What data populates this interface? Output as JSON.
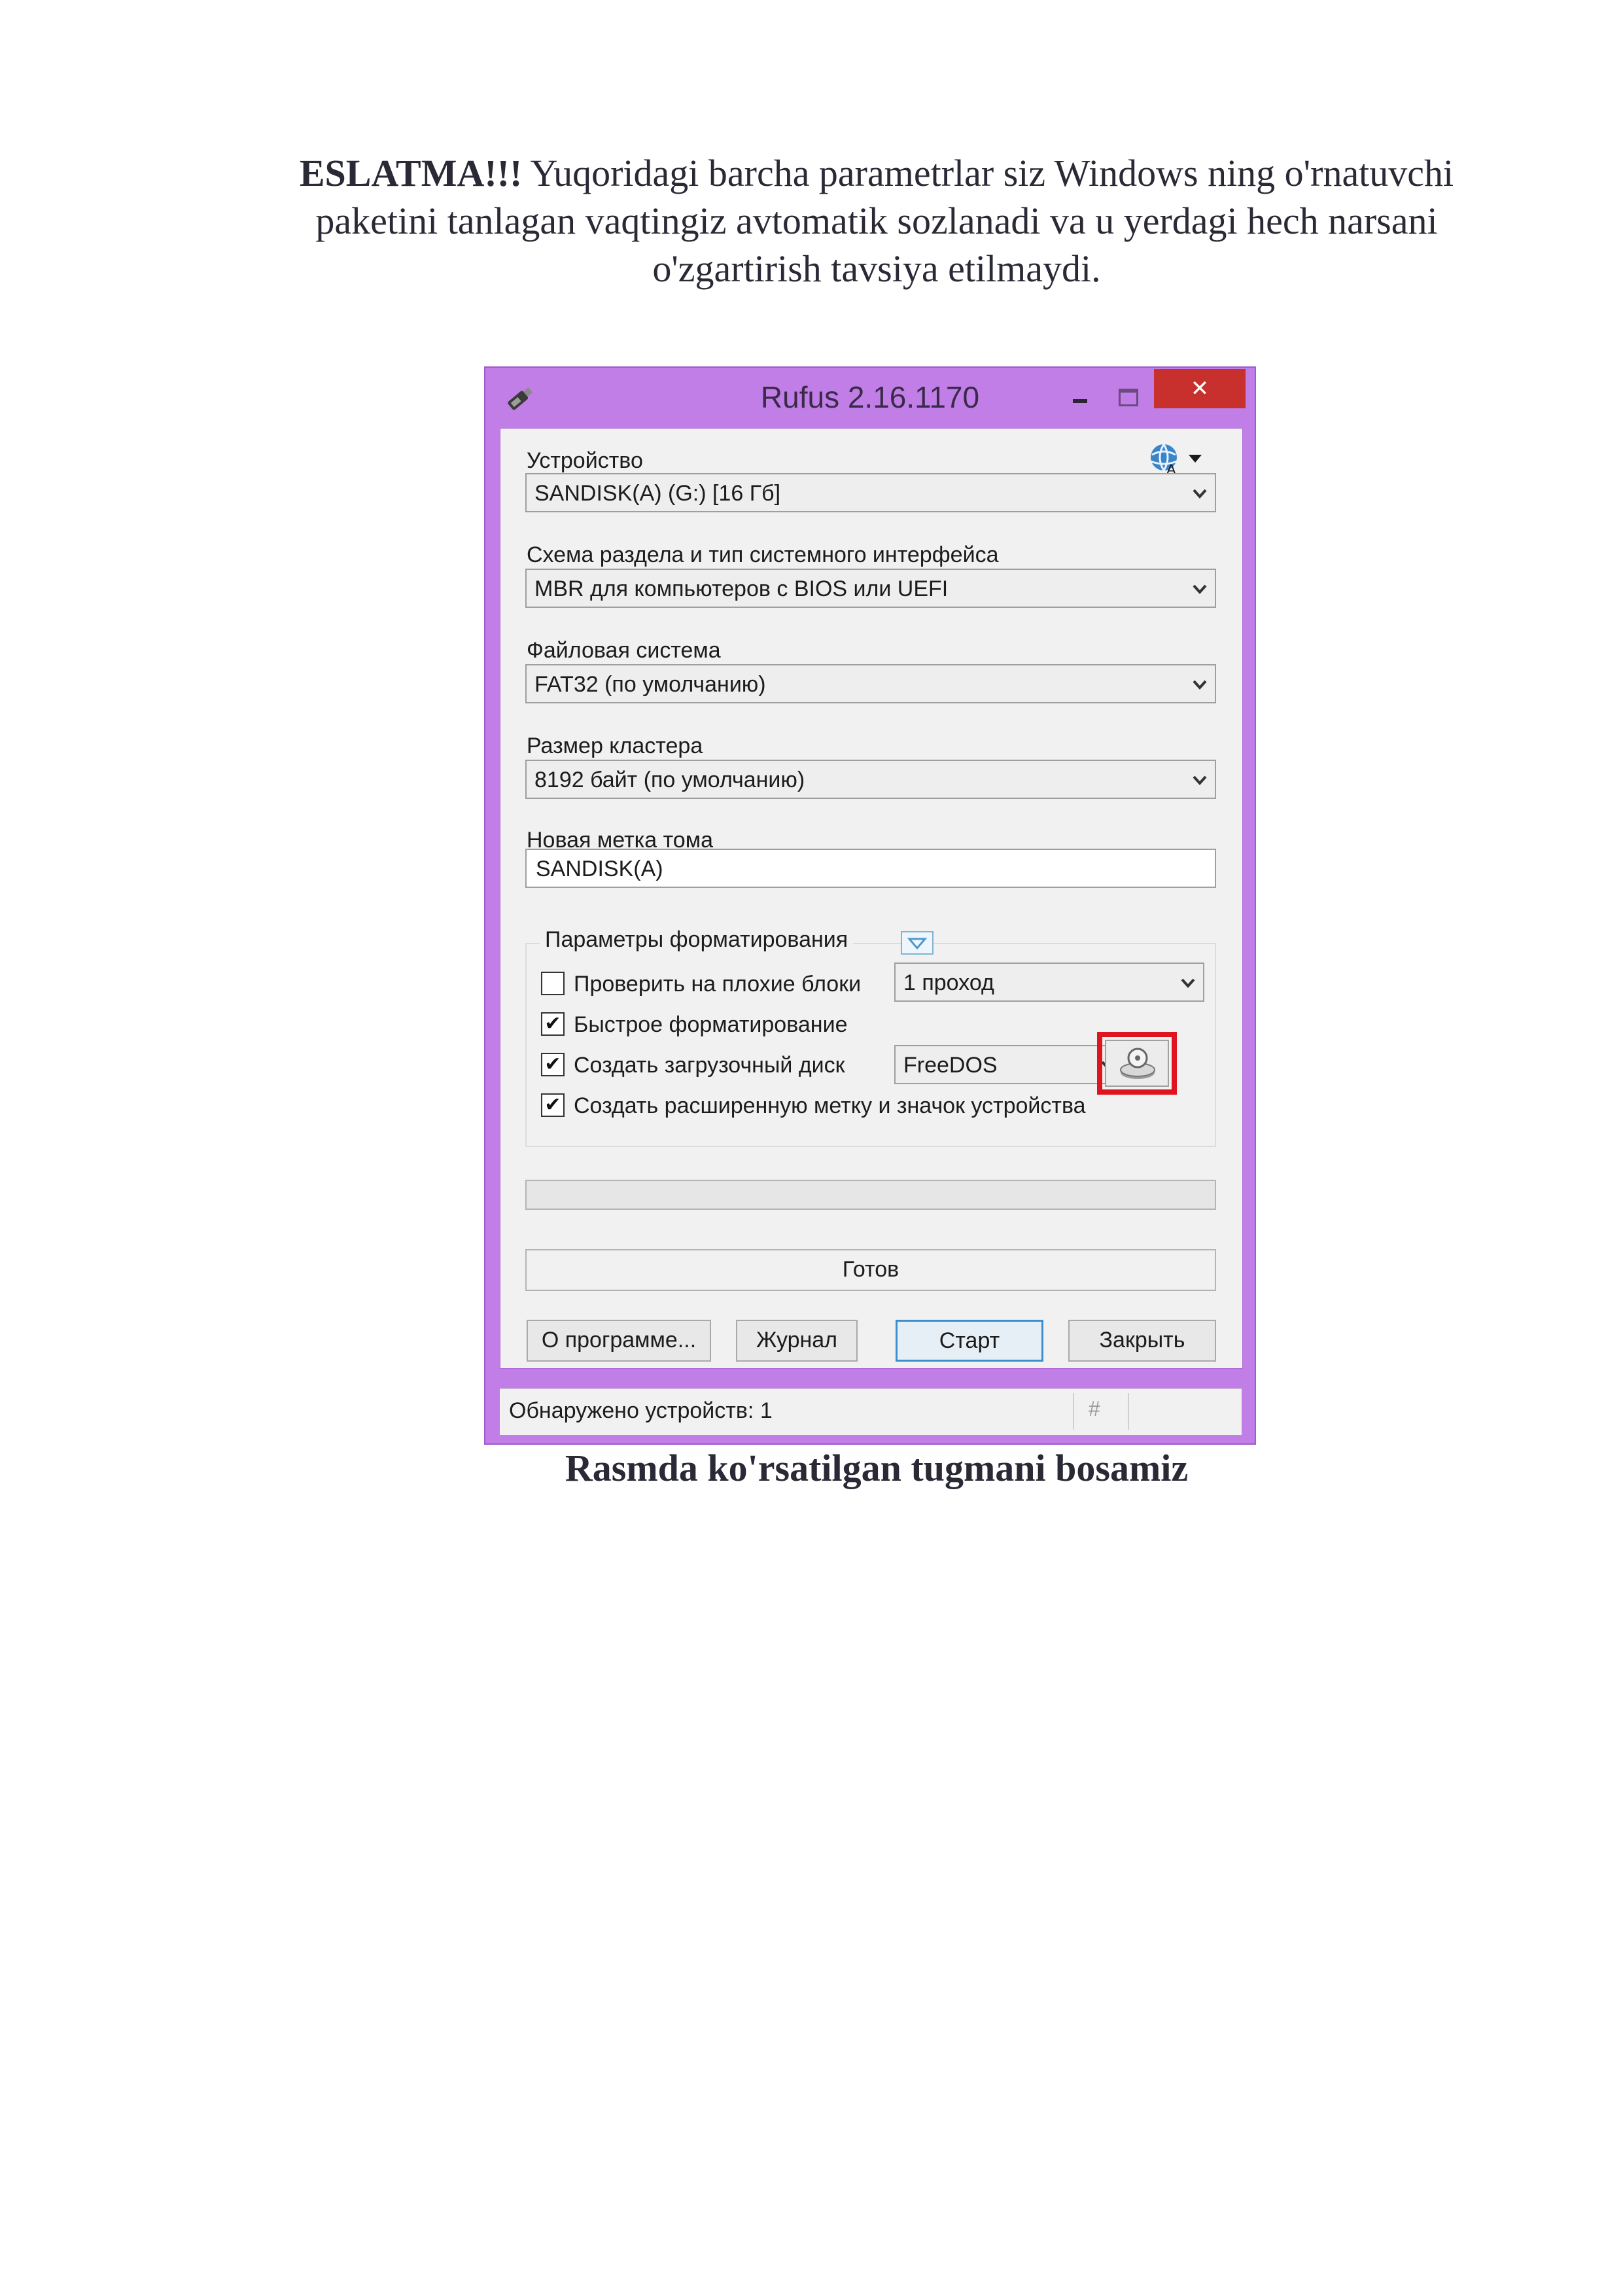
{
  "note": {
    "lead": "ESLATMA!!!",
    "lines": [
      " Yuqoridagi barcha parametrlar siz Windows ning o'rnatuvchi",
      "paketini tanlagan vaqtingiz avtomatik sozlanadi va u yerdagi hech narsani",
      "o'zgartirish tavsiya etilmaydi."
    ]
  },
  "window": {
    "title": "Rufus 2.16.1170",
    "close_glyph": "✕",
    "device_label": "Устройство",
    "device_value": "SANDISK(A) (G:) [16 Гб]",
    "scheme_label": "Схема раздела и тип системного интерфейса",
    "scheme_value": "MBR для компьютеров с BIOS или UEFI",
    "fs_label": "Файловая система",
    "fs_value": "FAT32 (по умолчанию)",
    "cluster_label": "Размер кластера",
    "cluster_value": "8192 байт (по умолчанию)",
    "volume_label": "Новая метка тома",
    "volume_value": "SANDISK(A)",
    "format_group_title": "Параметры форматирования",
    "check_bad_blocks": {
      "label": "Проверить на плохие блоки",
      "checked": false,
      "passes": "1 проход"
    },
    "quick_format": {
      "label": "Быстрое форматирование",
      "checked": true
    },
    "bootable": {
      "label": "Создать загрузочный диск",
      "checked": true,
      "type": "FreeDOS"
    },
    "extended_label": {
      "label": "Создать расширенную метку и значок устройства",
      "checked": true
    },
    "status": "Готов",
    "buttons": {
      "about": "О программе...",
      "log": "Журнал",
      "start": "Старт",
      "close": "Закрыть"
    },
    "statusbar": {
      "devices": "Обнаружено устройств: 1",
      "hash": "#"
    },
    "icons": [
      "usb-drive-icon",
      "language-globe-icon",
      "optical-disc-icon"
    ],
    "colors": {
      "frame": "#c17ee6",
      "close": "#c7302c",
      "highlight": "#e0141e",
      "primary_border": "#3b8ed0"
    }
  },
  "caption": "Rasmda ko'rsatilgan tugmani bosamiz"
}
